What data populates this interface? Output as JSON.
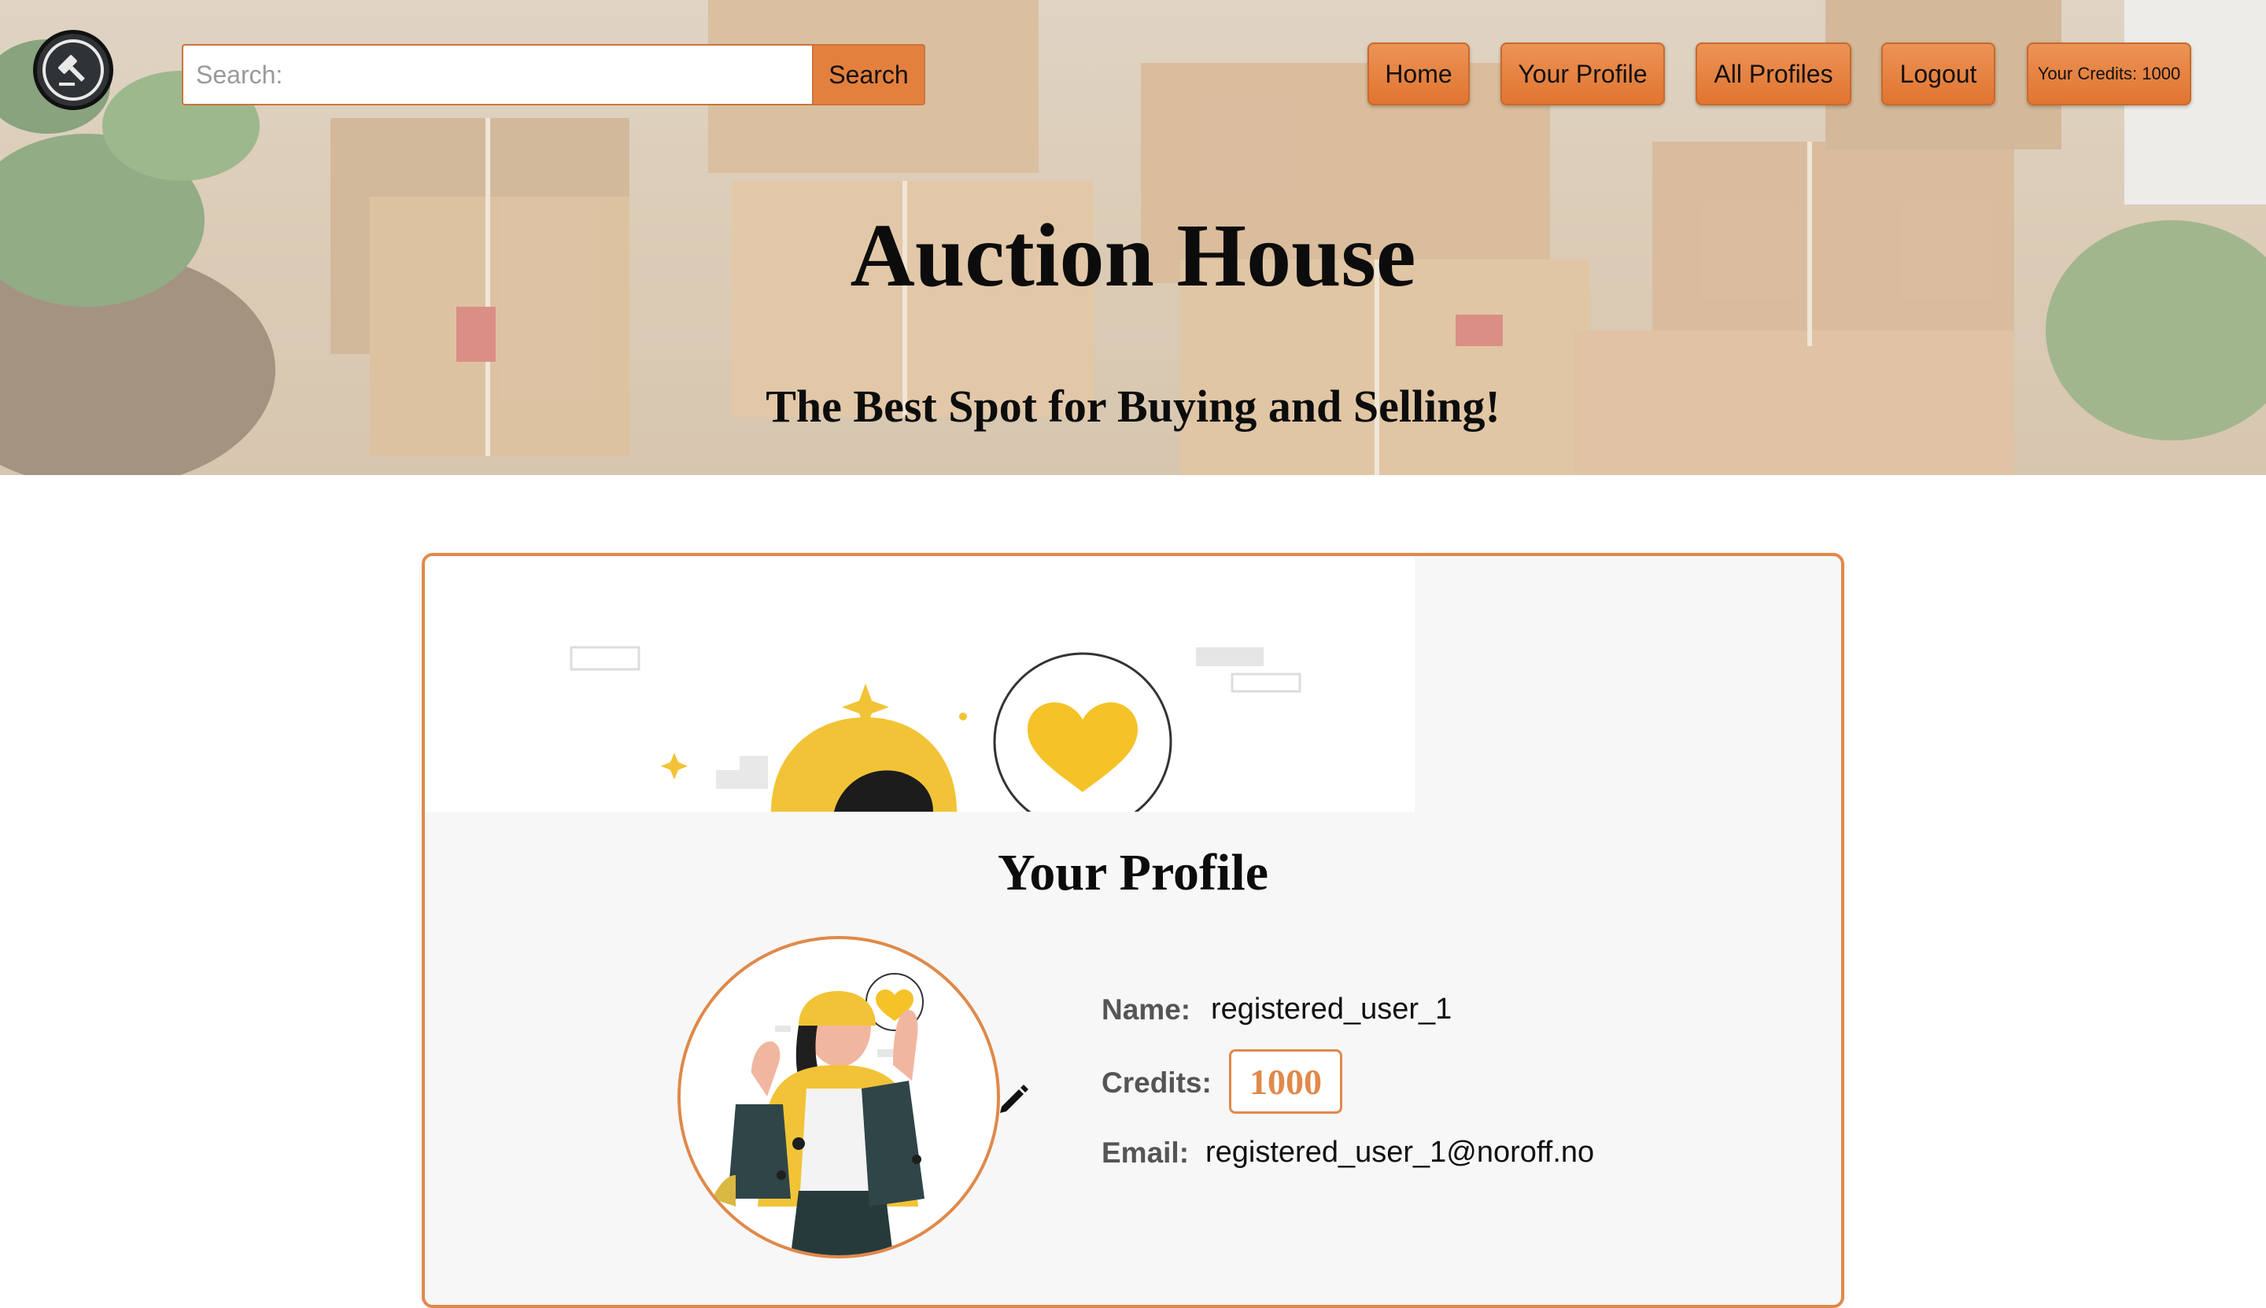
{
  "header": {
    "search": {
      "placeholder": "Search:",
      "value": "",
      "button_label": "Search"
    },
    "nav": {
      "home_label": "Home",
      "your_profile_label": "Your Profile",
      "all_profiles_label": "All Profiles",
      "logout_label": "Logout",
      "credits_label": "Your Credits: 1000"
    },
    "title": "Auction House",
    "subtitle": "The Best Spot for Buying and Selling!"
  },
  "profile": {
    "title": "Your Profile",
    "name_label": "Name:",
    "name_value": "registered_user_1",
    "credits_label": "Credits:",
    "credits_value": "1000",
    "email_label": "Email:",
    "email_value": "registered_user_1@noroff.no"
  },
  "colors": {
    "accent": "#e07530",
    "accent_border": "#e0894a",
    "card_bg": "#f7f7f7"
  },
  "icons": {
    "logo": "gavel-icon",
    "edit": "pencil-icon"
  }
}
